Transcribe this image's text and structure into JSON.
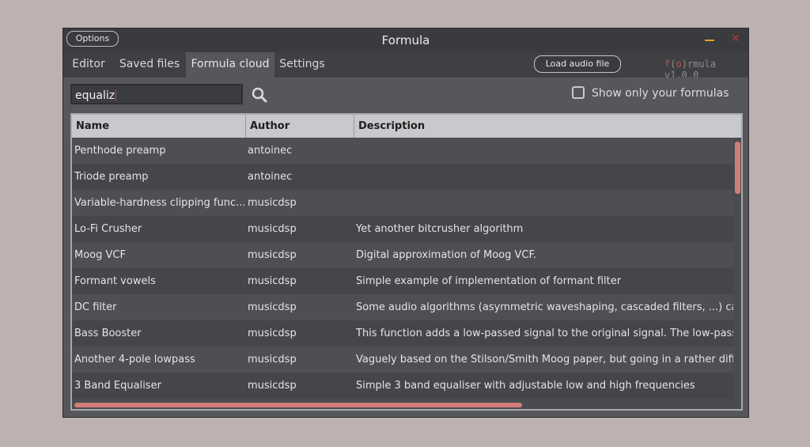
{
  "window": {
    "title": "Formula",
    "options_label": "Options",
    "load_audio_label": "Load audio file",
    "brand_f": "f",
    "brand_open": "(",
    "brand_o": "o",
    "brand_close": ")",
    "brand_rest": "rmula",
    "version": "v1.0.0"
  },
  "tabs": [
    {
      "label": "Editor"
    },
    {
      "label": "Saved files"
    },
    {
      "label": "Formula cloud",
      "active": true
    },
    {
      "label": "Settings"
    }
  ],
  "search": {
    "value": "equaliz",
    "icon": "search-icon"
  },
  "filter": {
    "checked": false,
    "label": "Show only your formulas"
  },
  "table": {
    "columns": [
      "Name",
      "Author",
      "Description"
    ],
    "rows": [
      {
        "name": "Penthode preamp",
        "author": "antoinec",
        "description": ""
      },
      {
        "name": "Triode preamp",
        "author": "antoinec",
        "description": ""
      },
      {
        "name": "Variable-hardness clipping func...",
        "author": "musicdsp",
        "description": ""
      },
      {
        "name": "Lo-Fi Crusher",
        "author": "musicdsp",
        "description": "Yet another bitcrusher algorithm"
      },
      {
        "name": "Moog VCF",
        "author": "musicdsp",
        "description": "Digital approximation of Moog VCF."
      },
      {
        "name": "Formant vowels",
        "author": "musicdsp",
        "description": "Simple example of implementation of formant filter"
      },
      {
        "name": "DC filter",
        "author": "musicdsp",
        "description": "Some audio algorithms (asymmetric waveshaping, cascaded filters, ...) car"
      },
      {
        "name": "Bass Booster",
        "author": "musicdsp",
        "description": "This function adds a low-passed signal to the original signal. The low-pass I"
      },
      {
        "name": "Another 4-pole lowpass",
        "author": "musicdsp",
        "description": "Vaguely based on the Stilson/Smith Moog paper, but going in a rather diffe"
      },
      {
        "name": "3 Band Equaliser",
        "author": "musicdsp",
        "description": "Simple 3 band equaliser with adjustable low and high frequencies"
      }
    ]
  },
  "colors": {
    "background": "#bdb1b1",
    "accent": "#d27d7a",
    "minimize": "#e1a31e",
    "close": "#b33a3a"
  }
}
